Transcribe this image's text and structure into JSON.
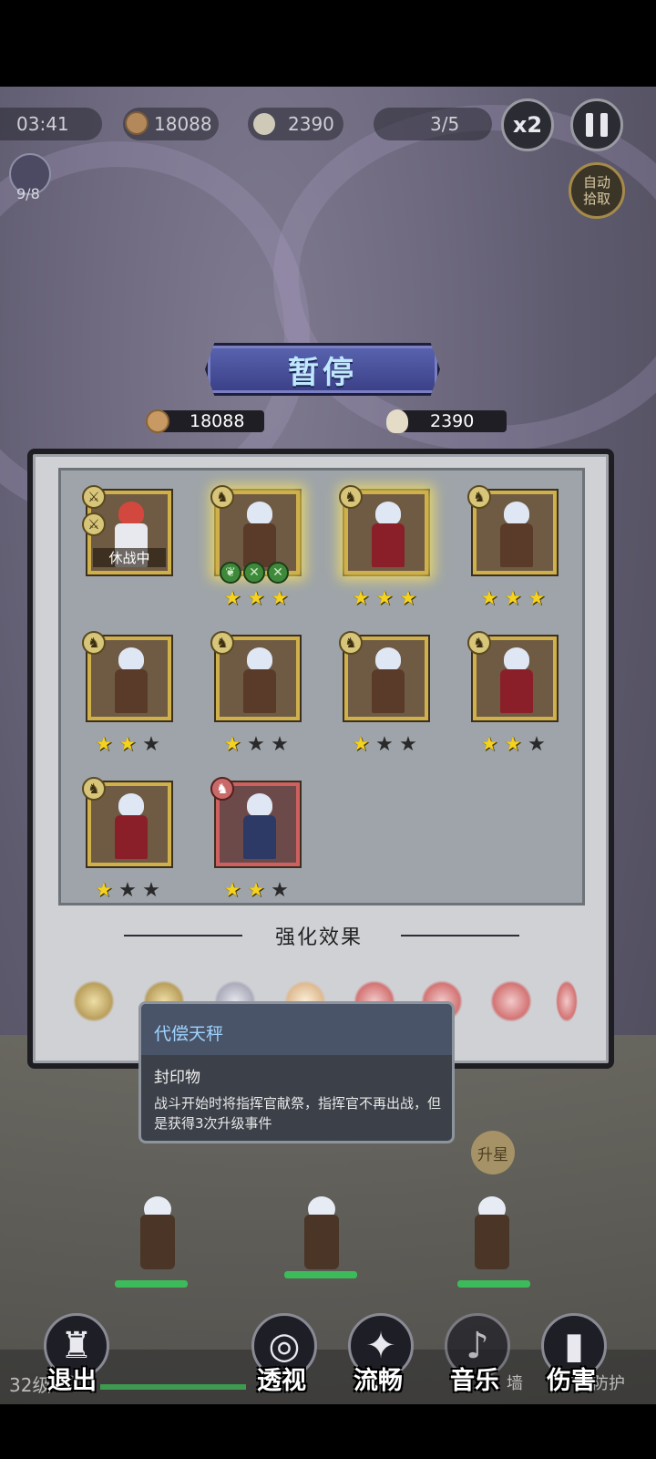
{
  "hud": {
    "timer": "03:41",
    "coins": "18088",
    "kills": "2390",
    "wave": "3/5",
    "speed": "x2",
    "auto_pick": "自动拾取",
    "level_count": "9/8"
  },
  "pause_title": "暂停",
  "currency": {
    "coins": "18088",
    "skulls": "2390"
  },
  "heroes": [
    {
      "rest_label": "休战中",
      "stars": 0,
      "skills": []
    },
    {
      "stars": 3,
      "glow": true,
      "skills": [
        "leaf",
        "cross",
        "cross"
      ]
    },
    {
      "stars": 3,
      "glow": true
    },
    {
      "stars": 3
    },
    {
      "stars": 2
    },
    {
      "stars": 1
    },
    {
      "stars": 1
    },
    {
      "stars": 2
    },
    {
      "stars": 1
    },
    {
      "stars": 2,
      "rare": true
    }
  ],
  "enhance_title": "强化效果",
  "tooltip": {
    "title": "代偿天秤",
    "subtitle": "封印物",
    "description": "战斗开始时将指挥官献祭，指挥官不再出战，但是获得3次升级事件"
  },
  "field": {
    "upgrade_label": "升星"
  },
  "bottom": {
    "level": "32级",
    "wall_label": "墙",
    "guard_label": "防护",
    "buttons": [
      {
        "label": "退出",
        "icon": "castle-icon"
      },
      {
        "label": "透视",
        "icon": "swirl-icon"
      },
      {
        "label": "流畅",
        "icon": "sparkle-icon"
      },
      {
        "label": "音乐",
        "icon": "speaker-icon"
      },
      {
        "label": "伤害",
        "icon": "bar-chart-icon"
      }
    ]
  },
  "colors": {
    "panel": "#cfd1d5",
    "banner": "#4a52a0",
    "gold_border": "#cfb04a",
    "star": "#f5d21e",
    "tooltip_title": "#9fd3ff"
  }
}
